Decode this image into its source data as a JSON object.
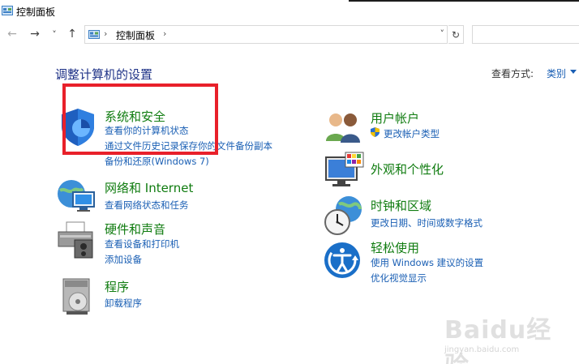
{
  "window": {
    "title": "控制面板"
  },
  "nav": {
    "back": "←",
    "forward": "→",
    "recent": "˅",
    "up": "↑",
    "address_separator": "›",
    "address_path": "控制面板",
    "address_dropdown": "˅",
    "refresh": "↻"
  },
  "header": {
    "title": "调整计算机的设置",
    "view_by_label": "查看方式:",
    "view_by_value": "类别"
  },
  "categories": [
    {
      "title": "系统和安全",
      "links": [
        "查看你的计算机状态",
        "通过文件历史记录保存你的文件备份副本",
        "备份和还原(Windows 7)"
      ],
      "icon": "shield-icon"
    },
    {
      "title": "网络和 Internet",
      "links": [
        "查看网络状态和任务"
      ],
      "icon": "network-globe-icon"
    },
    {
      "title": "硬件和声音",
      "links": [
        "查看设备和打印机",
        "添加设备"
      ],
      "icon": "printer-icon"
    },
    {
      "title": "程序",
      "links": [
        "卸载程序"
      ],
      "icon": "programs-disc-icon"
    },
    {
      "title": "用户帐户",
      "links": [
        "更改帐户类型"
      ],
      "icon": "users-icon"
    },
    {
      "title": "外观和个性化",
      "links": [],
      "icon": "monitor-palette-icon"
    },
    {
      "title": "时钟和区域",
      "links": [
        "更改日期、时间或数字格式"
      ],
      "icon": "clock-globe-icon"
    },
    {
      "title": "轻松使用",
      "links": [
        "使用 Windows 建议的设置",
        "优化视觉显示"
      ],
      "icon": "ease-of-access-icon"
    }
  ],
  "colors": {
    "heading": "#1e3287",
    "category_title": "#107c10",
    "link": "#1a5fb4",
    "highlight": "#e8202a"
  },
  "watermark": {
    "text": "Baidu经验",
    "sub": "jingyan.baidu.com"
  }
}
